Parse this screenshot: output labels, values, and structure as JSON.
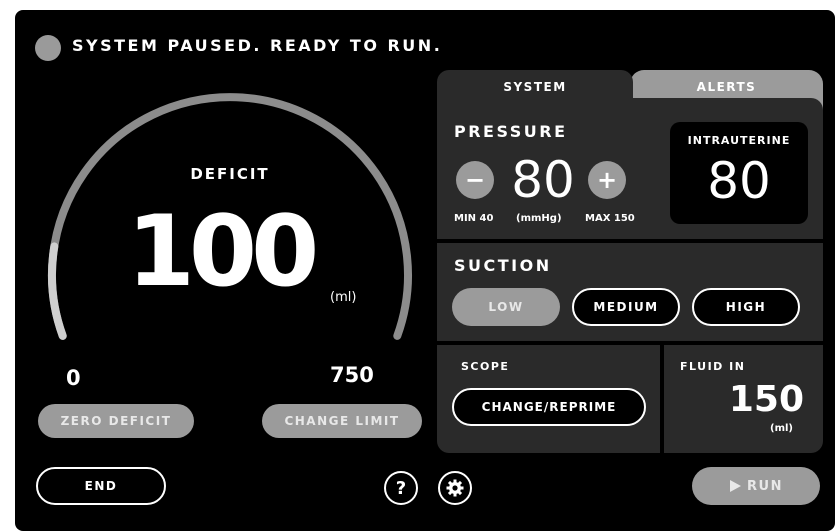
{
  "status": {
    "text": "SYSTEM PAUSED. READY TO RUN.",
    "indicator_color": "#9a9a9a"
  },
  "deficit": {
    "label": "DEFICIT",
    "value": "100",
    "unit": "(ml)",
    "range_min": "0",
    "range_max": "750",
    "fraction": 0.133
  },
  "buttons": {
    "zero_deficit": "ZERO DEFICIT",
    "change_limit": "CHANGE LIMIT",
    "end": "END",
    "help": "?",
    "run": "RUN",
    "run_icon": "play-icon",
    "settings_icon": "gear-icon"
  },
  "tabs": [
    {
      "label": "SYSTEM",
      "active": true
    },
    {
      "label": "ALERTS",
      "active": false
    }
  ],
  "pressure": {
    "title": "PRESSURE",
    "value": "80",
    "min_label": "MIN 40",
    "unit_label": "(mmHg)",
    "max_label": "MAX 150",
    "minus_symbol": "−",
    "plus_symbol": "+"
  },
  "intrauterine": {
    "label": "INTRAUTERINE",
    "value": "80"
  },
  "suction": {
    "title": "SUCTION",
    "options": [
      "LOW",
      "MEDIUM",
      "HIGH"
    ],
    "selected": "LOW"
  },
  "scope": {
    "title": "SCOPE",
    "button": "CHANGE/REPRIME"
  },
  "fluid_in": {
    "title": "FLUID IN",
    "value": "150",
    "unit": "(ml)"
  },
  "colors": {
    "background": "#000000",
    "card": "#2a2a2a",
    "accent_gray": "#9b9b9b",
    "text": "#ffffff"
  }
}
